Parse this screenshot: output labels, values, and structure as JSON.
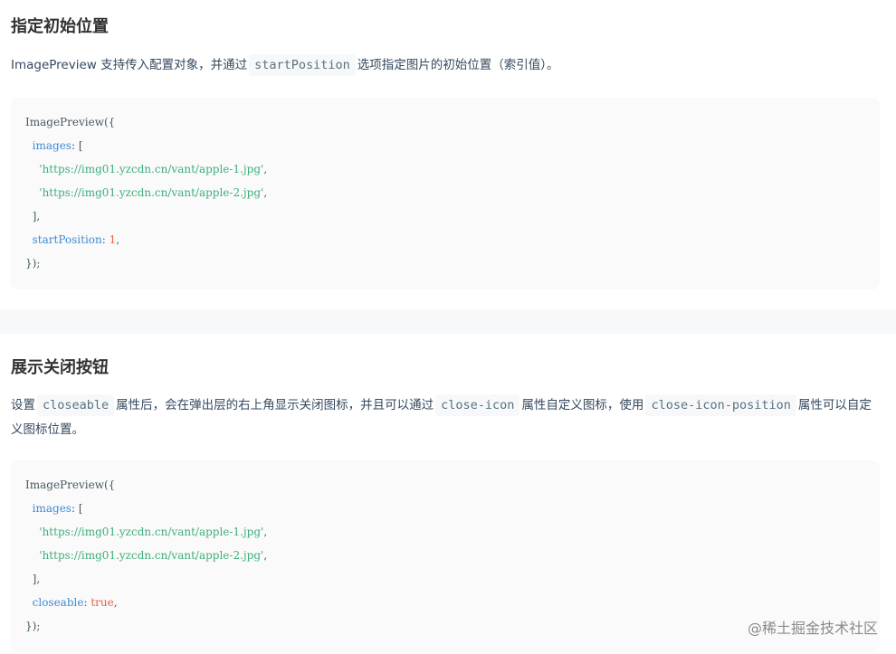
{
  "sections": [
    {
      "title": "指定初始位置",
      "desc": {
        "before": "ImagePreview 支持传入配置对象，并通过",
        "code": "startPosition",
        "after": "选项指定图片的初始位置（索引值）。"
      },
      "code": {
        "open": "ImagePreview({",
        "images_key": "images",
        "bracket_open": "[",
        "url1": "'https://img01.yzcdn.cn/vant/apple-1.jpg'",
        "url2": "'https://img01.yzcdn.cn/vant/apple-2.jpg'",
        "bracket_close": "],",
        "option_key": "startPosition",
        "option_value": "1",
        "close": "});"
      }
    },
    {
      "title": "展示关闭按钮",
      "desc": {
        "p1": "设置",
        "code1": "closeable",
        "p2": "属性后，会在弹出层的右上角显示关闭图标，并且可以通过",
        "code2": "close-icon",
        "p3": "属性自定义图标，使用",
        "code3": "close-icon-position",
        "p4": "属性可以自定义图标位置。"
      },
      "code": {
        "open": "ImagePreview({",
        "images_key": "images",
        "bracket_open": "[",
        "url1": "'https://img01.yzcdn.cn/vant/apple-1.jpg'",
        "url2": "'https://img01.yzcdn.cn/vant/apple-2.jpg'",
        "bracket_close": "],",
        "option_key": "closeable",
        "option_value": "true",
        "close": "});"
      }
    }
  ],
  "watermark": "@稀土掘金技术社区",
  "colors": {
    "background": "#f7f8fa",
    "prop": "#3e8bd6",
    "string": "#3fae7d",
    "value": "#e2624b"
  }
}
